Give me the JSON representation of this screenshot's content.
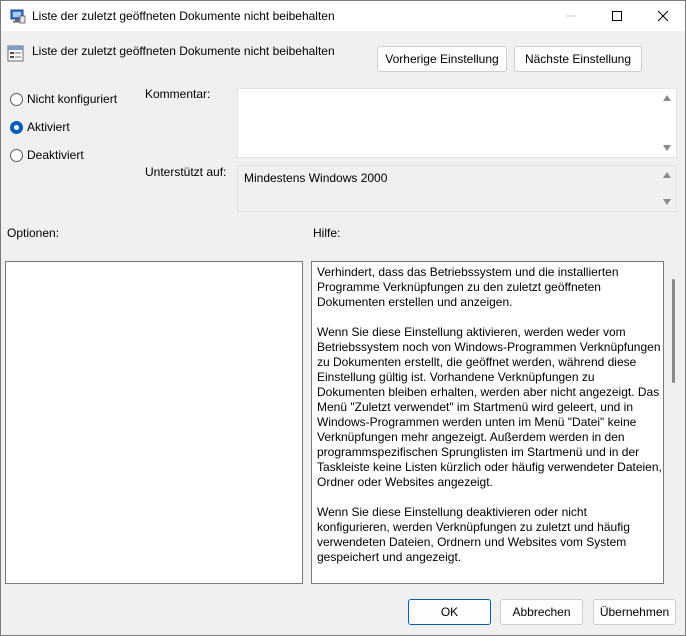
{
  "window": {
    "title": "Liste der zuletzt geöffneten Dokumente nicht beibehalten"
  },
  "header": {
    "policy_title": "Liste der zuletzt geöffneten Dokumente nicht beibehalten",
    "prev_label": "Vorherige Einstellung",
    "next_label": "Nächste Einstellung"
  },
  "state": {
    "options": [
      {
        "label": "Nicht konfiguriert",
        "checked": false
      },
      {
        "label": "Aktiviert",
        "checked": true
      },
      {
        "label": "Deaktiviert",
        "checked": false
      }
    ]
  },
  "comment": {
    "label": "Kommentar:",
    "value": ""
  },
  "supported": {
    "label": "Unterstützt auf:",
    "value": "Mindestens Windows 2000"
  },
  "sections": {
    "options_label": "Optionen:",
    "help_label": "Hilfe:"
  },
  "help": {
    "paragraphs": [
      "Verhindert, dass das Betriebssystem und die installierten Programme Verknüpfungen zu den zuletzt geöffneten Dokumenten erstellen und anzeigen.",
      "Wenn Sie diese Einstellung aktivieren, werden weder vom Betriebssystem noch von Windows-Programmen Verknüpfungen zu Dokumenten erstellt, die geöffnet werden, während diese Einstellung gültig ist. Vorhandene Verknüpfungen zu Dokumenten bleiben erhalten, werden aber nicht angezeigt. Das Menü \"Zuletzt verwendet\" im Startmenü wird geleert, und in Windows-Programmen werden unten im Menü \"Datei\" keine Verknüpfungen mehr angezeigt. Außerdem werden in den programmspezifischen Sprunglisten im Startmenü und in der Taskleiste keine Listen kürzlich oder häufig verwendeter Dateien, Ordner oder Websites angezeigt.",
      "Wenn Sie diese Einstellung deaktivieren oder nicht konfigurieren, werden Verknüpfungen zu zuletzt und häufig verwendeten Dateien, Ordnern und Websites vom System gespeichert und angezeigt."
    ]
  },
  "footer": {
    "ok_label": "OK",
    "cancel_label": "Abbrechen",
    "apply_label": "Übernehmen"
  },
  "colors": {
    "accent": "#005fb8",
    "background": "#f0f0f0"
  }
}
